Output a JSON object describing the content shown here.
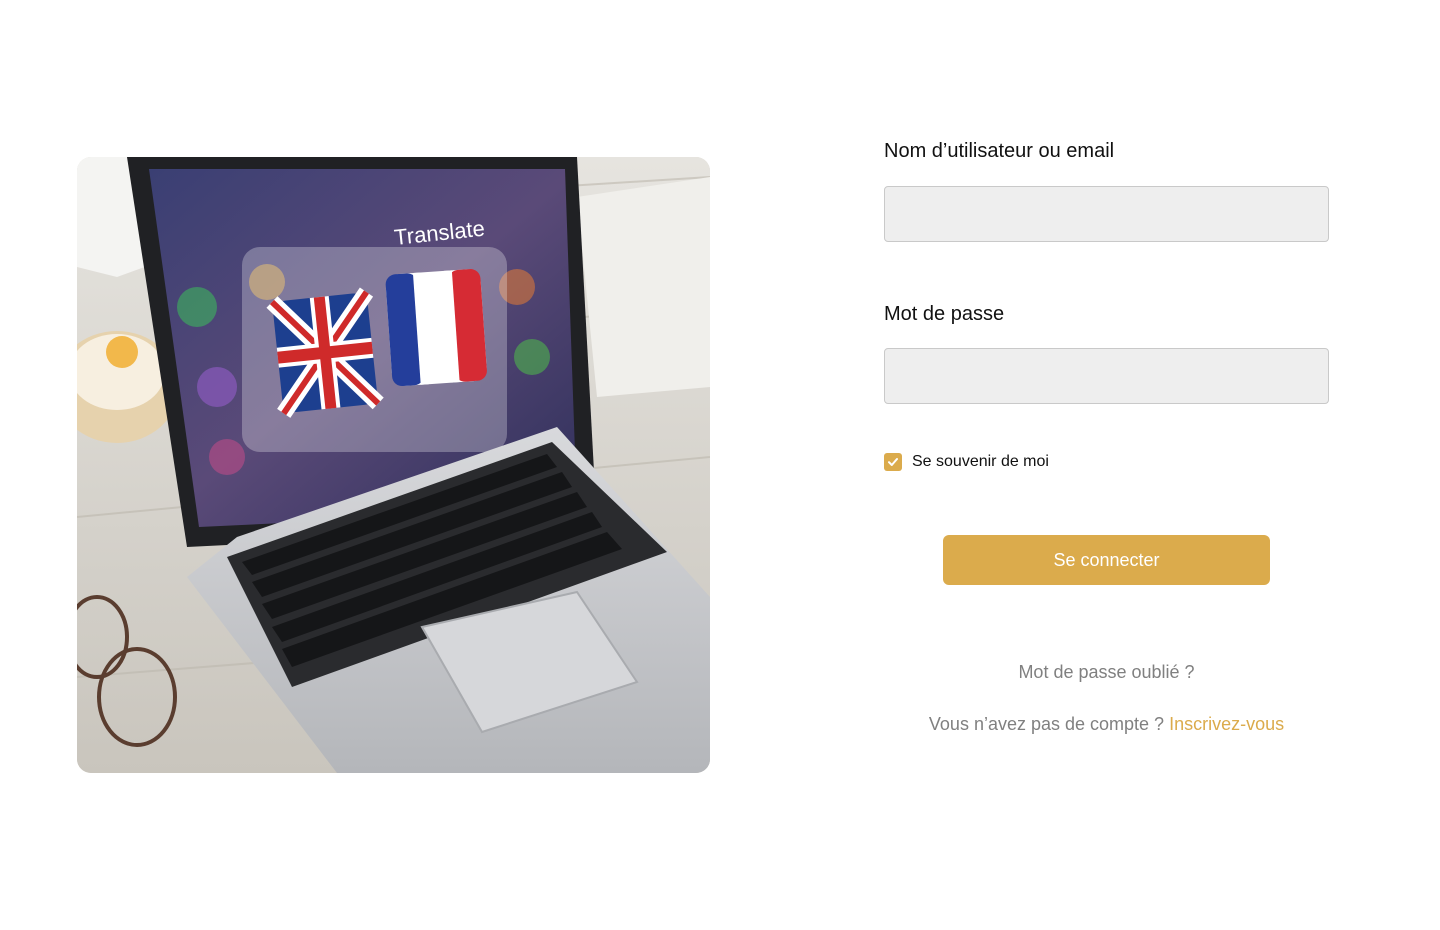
{
  "illustration": {
    "screen_text": "Translate",
    "left_flag": "uk-flag",
    "right_flag": "france-flag"
  },
  "form": {
    "username_label": "Nom d’utilisateur ou email",
    "username_value": "",
    "password_label": "Mot de passe",
    "password_value": "",
    "remember_label": "Se souvenir de moi",
    "remember_checked": true,
    "submit_label": "Se connecter",
    "forgot_label": "Mot de passe oublié ?",
    "signup_prompt": "Vous n’avez pas de compte ?",
    "signup_link": "Inscrivez-vous"
  },
  "colors": {
    "accent": "#dbab4c",
    "input_bg": "#eeeeee",
    "input_border": "#c9c9c9",
    "muted_text": "#808080",
    "text": "#111111"
  },
  "icons": {
    "checkbox": "check-icon"
  }
}
